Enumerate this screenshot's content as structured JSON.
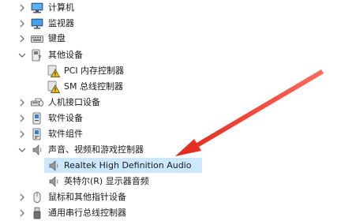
{
  "tree": {
    "computer": "计算机",
    "monitor": "监视器",
    "keyboard": "键盘",
    "other_devices": "其他设备",
    "pci_memory_controller": "PCI 内存控制器",
    "sm_bus_controller": "SM 总线控制器",
    "hid": "人机接口设备",
    "software_devices": "软件设备",
    "software_components": "软件组件",
    "sound_video_game": "声音、视频和游戏控制器",
    "realtek_audio": "Realtek High Definition Audio",
    "intel_display_audio": "英特尔(R) 显示器音频",
    "mice": "鼠标和其他指针设备",
    "usb_controllers": "通用串行总线控制器"
  },
  "colors": {
    "selection": "#cce8ff",
    "arrow": "#e53935",
    "warning": "#f4c20d"
  }
}
